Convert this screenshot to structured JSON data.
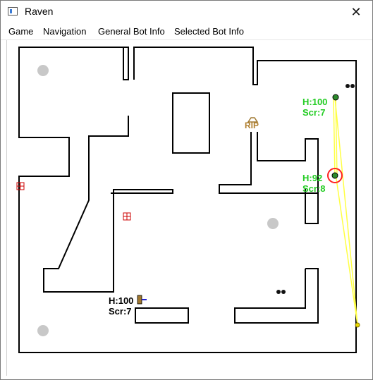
{
  "window": {
    "title": "Raven",
    "close_symbol": "✕"
  },
  "menu": {
    "items": [
      {
        "label": "Game"
      },
      {
        "label": "Navigation"
      },
      {
        "label": "General Bot Info"
      },
      {
        "label": "Selected Bot Info"
      }
    ]
  },
  "game": {
    "grave_marker": "RIP",
    "bots": [
      {
        "health": "H:100",
        "score": "Scr:7",
        "color": "#22cc22"
      },
      {
        "health": "H:92",
        "score": "Scr:8",
        "color": "#22cc22",
        "selected": true
      },
      {
        "health": "H:100",
        "score": "Scr:7",
        "color": "#000000"
      }
    ],
    "colors": {
      "walls": "#000000",
      "spawn_points": "#c8c8c8",
      "trajectory": "#ffff44",
      "selection_ring": "#ff2222",
      "health_pack": "#cc0000"
    }
  }
}
